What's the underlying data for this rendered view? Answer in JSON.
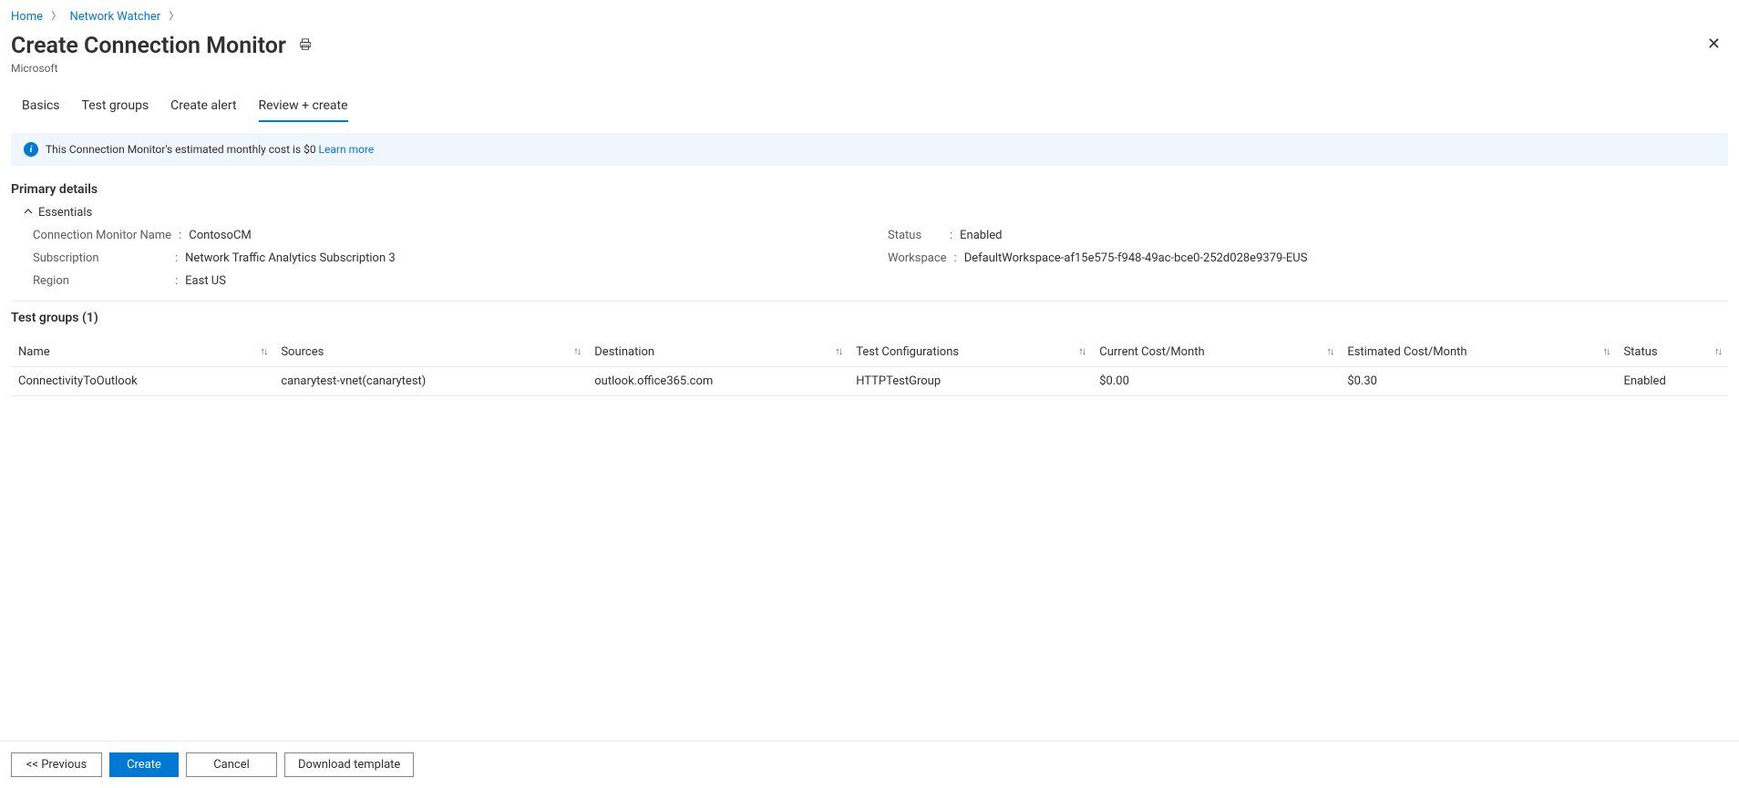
{
  "breadcrumb": {
    "home": "Home",
    "network_watcher": "Network Watcher"
  },
  "header": {
    "title": "Create Connection Monitor",
    "subtitle": "Microsoft"
  },
  "tabs": {
    "basics": "Basics",
    "test_groups": "Test groups",
    "create_alert": "Create alert",
    "review_create": "Review + create"
  },
  "banner": {
    "text": "This Connection Monitor's estimated monthly cost is $0 ",
    "link": "Learn more"
  },
  "sections": {
    "primary_details": "Primary details",
    "essentials_label": "Essentials",
    "test_groups_title": "Test groups (1)"
  },
  "essentials": {
    "conn_name_label": "Connection Monitor Name",
    "conn_name_value": "ContosoCM",
    "subscription_label": "Subscription",
    "subscription_value": "Network Traffic Analytics Subscription 3",
    "region_label": "Region",
    "region_value": "East US",
    "status_label": "Status",
    "status_value": "Enabled",
    "workspace_label": "Workspace",
    "workspace_value": "DefaultWorkspace-af15e575-f948-49ac-bce0-252d028e9379-EUS"
  },
  "table": {
    "headers": {
      "name": "Name",
      "sources": "Sources",
      "destination": "Destination",
      "test_config": "Test Configurations",
      "current_cost": "Current Cost/Month",
      "est_cost": "Estimated Cost/Month",
      "status": "Status"
    },
    "row": {
      "name": "ConnectivityToOutlook",
      "sources": "canarytest-vnet(canarytest)",
      "destination": "outlook.office365.com",
      "test_config": "HTTPTestGroup",
      "current_cost": "$0.00",
      "est_cost": "$0.30",
      "status": "Enabled"
    }
  },
  "buttons": {
    "previous": "<< Previous",
    "create": "Create",
    "cancel": "Cancel",
    "download": "Download template"
  }
}
